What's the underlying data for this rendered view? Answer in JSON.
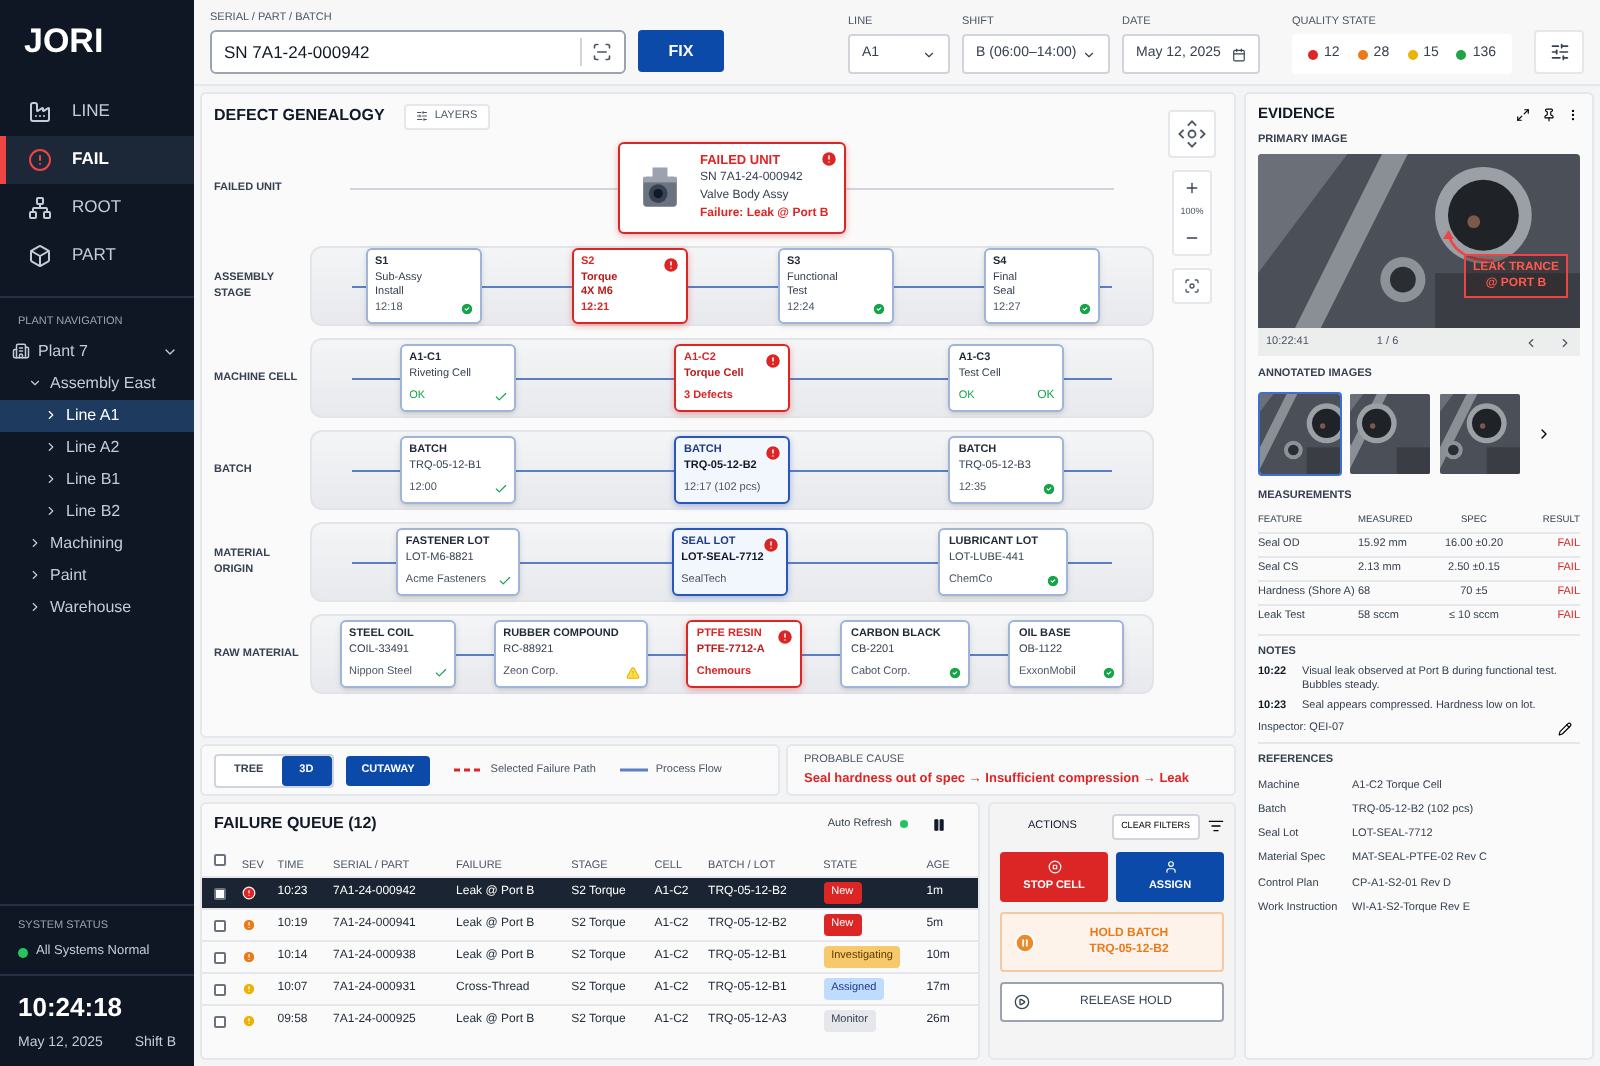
{
  "sidebar": {
    "logo": "JORI",
    "nav": [
      {
        "label": "LINE",
        "selected": false
      },
      {
        "label": "FAIL",
        "selected": true
      },
      {
        "label": "ROOT",
        "selected": false
      },
      {
        "label": "PART",
        "selected": false
      }
    ]
  },
  "plant_navigation": {
    "title": "PLANT NAVIGATION",
    "tree": [
      {
        "label": "Plant 7",
        "expanded": true,
        "selected": false,
        "children": [
          {
            "label": "Assembly East",
            "expanded": true,
            "selected": false,
            "children": [
              {
                "label": "Line A1",
                "expanded": false,
                "selected": true
              },
              {
                "label": "Line A2",
                "expanded": false,
                "selected": false
              },
              {
                "label": "Line B1",
                "expanded": false,
                "selected": false
              },
              {
                "label": "Line B2",
                "expanded": false,
                "selected": false
              }
            ]
          },
          {
            "label": "Machining",
            "expanded": false,
            "selected": false
          },
          {
            "label": "Paint",
            "expanded": false,
            "selected": false
          },
          {
            "label": "Warehouse",
            "expanded": false,
            "selected": false
          }
        ]
      }
    ]
  },
  "system_status": {
    "title": "SYSTEM STATUS",
    "status": "All Systems Normal",
    "ok": true
  },
  "clock": {
    "time": "10:24:18",
    "date": "May 12, 2025",
    "shift": "Shift B"
  },
  "top_bar": {
    "search": {
      "label": "SERIAL / PART / BATCH",
      "value": "SN 7A1-24-000942"
    },
    "fix_button": "FIX",
    "line": {
      "label": "LINE",
      "value": "A1"
    },
    "shift": {
      "label": "SHIFT",
      "value": "B (06:00–14:00)"
    },
    "date": {
      "label": "DATE",
      "value": "May 12, 2025"
    },
    "quality_state": {
      "label": "QUALITY STATE",
      "counts": [
        {
          "count": "12",
          "color": "#dc2626"
        },
        {
          "count": "28",
          "color": "#ea7a1a"
        },
        {
          "count": "15",
          "color": "#eab308"
        },
        {
          "count": "136",
          "color": "#22a348"
        }
      ]
    }
  },
  "genealogy": {
    "title": "DEFECT GENEALOGY",
    "layers_button": "LAYERS",
    "zoom_level": "100%",
    "layers": [
      {
        "label": "FAILED UNIT",
        "nodes": [
          {
            "kind": "unit",
            "title": "FAILED UNIT",
            "lines": [
              "SN 7A1-24-000942",
              "Valve Body Assy"
            ],
            "footer": "Failure: Leak @ Port B",
            "passed": false,
            "marker": {
              "kind": "alert"
            }
          }
        ]
      },
      {
        "label": "ASSEMBLY STAGE",
        "nodes": [
          {
            "kind": "normal",
            "title": "S1",
            "lines": [
              "Sub-Assy",
              "Install"
            ],
            "footer": "12:18",
            "passed": false,
            "marker": {
              "kind": "check-circle"
            }
          },
          {
            "kind": "failure",
            "title": "S2",
            "lines": [
              "Torque",
              "4X M6"
            ],
            "footer": "12:21",
            "passed": false,
            "marker": {
              "kind": "alert"
            }
          },
          {
            "kind": "normal",
            "title": "S3",
            "lines": [
              "Functional",
              "Test"
            ],
            "footer": "12:24",
            "passed": false,
            "marker": {
              "kind": "check-circle"
            }
          },
          {
            "kind": "normal",
            "title": "S4",
            "lines": [
              "Final",
              "Seal"
            ],
            "footer": "12:27",
            "passed": false,
            "marker": {
              "kind": "check-circle"
            }
          }
        ]
      },
      {
        "label": "MACHINE CELL",
        "nodes": [
          {
            "kind": "normal",
            "title": "A1-C1",
            "lines": [
              "Riveting Cell"
            ],
            "footer": "OK",
            "passed": true,
            "marker": {
              "kind": "tick"
            }
          },
          {
            "kind": "failure",
            "title": "A1-C2",
            "lines": [
              "Torque Cell"
            ],
            "footer": "3 Defects",
            "passed": false,
            "marker": {
              "kind": "alert"
            }
          },
          {
            "kind": "normal",
            "title": "A1-C3",
            "lines": [
              "Test Cell"
            ],
            "footer": "OK",
            "passed": true,
            "marker": {
              "kind": "text",
              "text": "OK"
            }
          }
        ]
      },
      {
        "label": "BATCH",
        "nodes": [
          {
            "kind": "normal",
            "title": "BATCH",
            "lines": [
              "TRQ-05-12-B1"
            ],
            "footer": "12:00",
            "passed": false,
            "marker": {
              "kind": "tick"
            }
          },
          {
            "kind": "highlight",
            "title": "BATCH",
            "lines": [
              "TRQ-05-12-B2"
            ],
            "footer": "12:17 (102 pcs)",
            "passed": false,
            "marker": {
              "kind": "alert"
            }
          },
          {
            "kind": "normal",
            "title": "BATCH",
            "lines": [
              "TRQ-05-12-B3"
            ],
            "footer": "12:35",
            "passed": false,
            "marker": {
              "kind": "check-circle"
            }
          }
        ]
      },
      {
        "label": "MATERIAL ORIGIN",
        "nodes": [
          {
            "kind": "normal",
            "title": "FASTENER LOT",
            "lines": [
              "LOT-M6-8821"
            ],
            "footer": "Acme Fasteners",
            "passed": false,
            "marker": {
              "kind": "tick"
            }
          },
          {
            "kind": "highlight",
            "title": "SEAL LOT",
            "lines": [
              "LOT-SEAL-7712"
            ],
            "footer": "SealTech",
            "passed": false,
            "marker": {
              "kind": "alert"
            }
          },
          {
            "kind": "normal",
            "title": "LUBRICANT LOT",
            "lines": [
              "LOT-LUBE-441"
            ],
            "footer": "ChemCo",
            "passed": false,
            "marker": {
              "kind": "check-circle"
            }
          }
        ]
      },
      {
        "label": "RAW MATERIAL",
        "nodes": [
          {
            "kind": "normal",
            "title": "STEEL COIL",
            "lines": [
              "COIL-33491"
            ],
            "footer": "Nippon Steel",
            "passed": false,
            "marker": {
              "kind": "tick"
            }
          },
          {
            "kind": "normal",
            "title": "RUBBER COMPOUND",
            "lines": [
              "RC-88921"
            ],
            "footer": "Zeon Corp.",
            "passed": false,
            "marker": {
              "kind": "warning"
            }
          },
          {
            "kind": "failure",
            "title": "PTFE RESIN",
            "lines": [
              "PTFE-7712-A"
            ],
            "footer": "Chemours",
            "passed": false,
            "marker": {
              "kind": "alert"
            }
          },
          {
            "kind": "normal",
            "title": "CARBON BLACK",
            "lines": [
              "CB-2201"
            ],
            "footer": "Cabot Corp.",
            "passed": false,
            "marker": {
              "kind": "check-circle"
            }
          },
          {
            "kind": "normal",
            "title": "OIL BASE",
            "lines": [
              "OB-1122"
            ],
            "footer": "ExxonMobil",
            "passed": false,
            "marker": {
              "kind": "check-circle"
            }
          }
        ]
      }
    ]
  },
  "view_controls": {
    "views": [
      {
        "label": "TREE",
        "selected": false
      },
      {
        "label": "3D",
        "selected": true
      }
    ],
    "cutaway_button": "CUTAWAY",
    "legend": [
      {
        "kind": "dashed",
        "label": "Selected Failure Path"
      },
      {
        "kind": "solid",
        "label": "Process Flow"
      }
    ]
  },
  "probable_cause": {
    "label": "PROBABLE CAUSE",
    "text": "Seal hardness out of spec → Insufficient compression → Leak"
  },
  "failure_queue": {
    "title": "FAILURE QUEUE (12)",
    "auto_refresh": "Auto Refresh",
    "auto_refresh_on": true,
    "all_checked": false,
    "columns": [
      "SEV",
      "TIME",
      "SERIAL / PART",
      "FAILURE",
      "STAGE",
      "CELL",
      "BATCH / LOT",
      "STATE",
      "AGE"
    ],
    "rows": [
      {
        "selected": true,
        "checked": false,
        "color": "#dc2626",
        "time": "10:23",
        "serial": "7A1-24-000942",
        "failure": "Leak @ Port B",
        "stage": "S2 Torque",
        "cell": "A1-C2",
        "batch": "TRQ-05-12-B2",
        "state": {
          "label": "New",
          "kind": "new"
        },
        "age": "1m"
      },
      {
        "selected": false,
        "checked": false,
        "color": "#ea7a1a",
        "time": "10:19",
        "serial": "7A1-24-000941",
        "failure": "Leak @ Port B",
        "stage": "S2 Torque",
        "cell": "A1-C2",
        "batch": "TRQ-05-12-B2",
        "state": {
          "label": "New",
          "kind": "new"
        },
        "age": "5m"
      },
      {
        "selected": false,
        "checked": false,
        "color": "#ea7a1a",
        "time": "10:14",
        "serial": "7A1-24-000938",
        "failure": "Leak @ Port B",
        "stage": "S2 Torque",
        "cell": "A1-C2",
        "batch": "TRQ-05-12-B1",
        "state": {
          "label": "Investigating",
          "kind": "investigating"
        },
        "age": "10m"
      },
      {
        "selected": false,
        "checked": false,
        "color": "#eab308",
        "time": "10:07",
        "serial": "7A1-24-000931",
        "failure": "Cross-Thread",
        "stage": "S2 Torque",
        "cell": "A1-C2",
        "batch": "TRQ-05-12-B1",
        "state": {
          "label": "Assigned",
          "kind": "assigned"
        },
        "age": "17m"
      },
      {
        "selected": false,
        "checked": false,
        "color": "#eab308",
        "time": "09:58",
        "serial": "7A1-24-000925",
        "failure": "Leak @ Port B",
        "stage": "S2 Torque",
        "cell": "A1-C2",
        "batch": "TRQ-05-12-A3",
        "state": {
          "label": "Monitor",
          "kind": "monitor"
        },
        "age": "26m"
      }
    ]
  },
  "actions": {
    "title": "ACTIONS",
    "clear_filters": "CLEAR FILTERS",
    "buttons": [
      {
        "kind": "stop",
        "label": "STOP CELL"
      },
      {
        "kind": "assign",
        "label": "ASSIGN"
      },
      {
        "kind": "hold",
        "label": "HOLD BATCH",
        "sublabel": "TRQ-05-12-B2"
      },
      {
        "kind": "release",
        "label": "RELEASE HOLD"
      }
    ]
  },
  "evidence": {
    "title": "EVIDENCE",
    "primary_label": "PRIMARY IMAGE",
    "annotation": "LEAK TRANCE @ PORT B",
    "timestamp": "10:22:41",
    "pager": "1 / 6",
    "annotated_label": "ANNOTATED IMAGES",
    "thumbnails": [
      {
        "selected": true
      },
      {
        "selected": false
      },
      {
        "selected": false
      }
    ],
    "measurements": {
      "title": "MEASUREMENTS",
      "columns": [
        "FEATURE",
        "MEASURED",
        "SPEC",
        "RESULT"
      ],
      "rows": [
        {
          "feature": "Seal OD",
          "measured": "15.92 mm",
          "spec": "16.00 ±0.20",
          "result": "FAIL",
          "failed": true
        },
        {
          "feature": "Seal CS",
          "measured": "2.13 mm",
          "spec": "2.50 ±0.15",
          "result": "FAIL",
          "failed": true
        },
        {
          "feature": "Hardness (Shore A)",
          "measured": "68",
          "spec": "70 ±5",
          "result": "FAIL",
          "failed": true
        },
        {
          "feature": "Leak Test",
          "measured": "58 sccm",
          "spec": "≤ 10 sccm",
          "result": "FAIL",
          "failed": true
        }
      ]
    },
    "notes": {
      "title": "NOTES",
      "entries": [
        {
          "time": "10:22",
          "text": "Visual leak observed at Port B during functional test. Bubbles steady."
        },
        {
          "time": "10:23",
          "text": "Seal appears compressed. Hardness low on lot."
        }
      ],
      "inspector": "Inspector: QEI-07"
    },
    "references": {
      "title": "REFERENCES",
      "rows": [
        {
          "label": "Machine",
          "value": "A1-C2 Torque Cell"
        },
        {
          "label": "Batch",
          "value": "TRQ-05-12-B2 (102 pcs)"
        },
        {
          "label": "Seal Lot",
          "value": "LOT-SEAL-7712"
        },
        {
          "label": "Material Spec",
          "value": "MAT-SEAL-PTFE-02 Rev C"
        },
        {
          "label": "Control Plan",
          "value": "CP-A1-S2-01 Rev D"
        },
        {
          "label": "Work Instruction",
          "value": "WI-A1-S2-Torque Rev E"
        }
      ]
    }
  }
}
